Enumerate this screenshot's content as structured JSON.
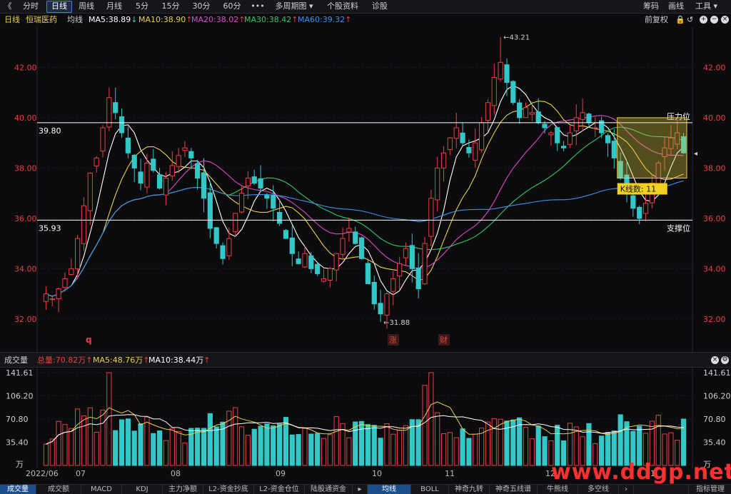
{
  "toolbar": {
    "back": "《",
    "tabs": [
      "分时",
      "日线",
      "周线",
      "月线",
      "5分",
      "15分",
      "30分",
      "60分",
      "•••",
      "多周期图 ▾",
      "个股资料",
      "诊股"
    ],
    "active_tab": "日线",
    "right_items": [
      "筹码",
      "画线",
      "工具 ▾"
    ]
  },
  "info": {
    "period": "日线",
    "stock_name": "恒瑞医药",
    "avg_label": "均线",
    "ma5": "MA5:38.89",
    "ma10": "MA10:38.90",
    "ma20": "MA20:38.02",
    "ma30": "MA30:38.42",
    "ma60": "MA60:39.32",
    "ma5_arrow": "↓",
    "ma10_arrow": "↑",
    "ma20_arrow": "↑",
    "ma30_arrow": "↑",
    "ma60_arrow": "↑",
    "adjust": "前复权"
  },
  "colors": {
    "up": "#e84040",
    "down": "#33c8c8",
    "ma5": "#ffffff",
    "ma10": "#e8d048",
    "ma20": "#e048c8",
    "ma30": "#30c860",
    "ma60": "#3a90e8",
    "axis_text": "#e84040"
  },
  "price_axis": {
    "labels": [
      "42.00",
      "40.00",
      "38.00",
      "36.00",
      "34.00",
      "32.00"
    ]
  },
  "annotations": {
    "high": "43.21",
    "low": "31.88",
    "resistance_value": "39.80",
    "support_value": "35.93",
    "resistance_label": "压力位",
    "support_label": "支撑位",
    "kline_count": "K线数: 11",
    "event_q": "q",
    "event_zhang": "涨",
    "event_cai": "财"
  },
  "volume": {
    "title": "成交量",
    "total": "总量:70.82万",
    "ma5": "MA5:48.76万",
    "ma10": "MA10:38.44万",
    "total_arrow": "↑",
    "ma5_arrow": "↑",
    "ma10_arrow": "↑",
    "axis_labels": [
      "141.61",
      "106.20",
      "70.80",
      "35.40",
      "万"
    ]
  },
  "x_dates": [
    "2022/06",
    "07",
    "08",
    "09",
    "10",
    "11",
    "12",
    "01"
  ],
  "bottom_tabs": [
    "成交量",
    "成交额",
    "MACD",
    "KDJ",
    "主力净额",
    "L2-资金抄底",
    "L2-资金仓位",
    "陆股通资金",
    "▸",
    "均线",
    "BOLL",
    "神奇九转",
    "神奇五线谱",
    "牛熊线",
    "多空线",
    "›",
    "指标管理"
  ],
  "active_bottom_left": "成交量",
  "active_bottom_right": "均线",
  "watermark": "www.ddgp.net",
  "chart_data": {
    "type": "candlestick",
    "title": "恒瑞医药 日线",
    "x": [
      "2022/06",
      "07",
      "08",
      "09",
      "10",
      "11",
      "12",
      "01"
    ],
    "ylim": [
      31.4,
      43.6
    ],
    "key_prices": {
      "high": 43.21,
      "low": 31.88,
      "resistance": 39.8,
      "support": 35.93
    },
    "closes": [
      33.0,
      32.8,
      33.2,
      33.6,
      34.0,
      35.2,
      36.5,
      37.8,
      38.4,
      39.6,
      40.8,
      40.2,
      39.4,
      38.6,
      38.0,
      37.4,
      38.2,
      37.9,
      37.2,
      37.6,
      38.1,
      38.5,
      38.8,
      38.4,
      37.6,
      36.8,
      35.6,
      35.0,
      34.4,
      35.2,
      36.2,
      37.0,
      37.6,
      37.4,
      37.2,
      36.8,
      36.4,
      35.8,
      35.2,
      34.6,
      34.2,
      34.6,
      34.0,
      33.8,
      33.6,
      34.0,
      34.6,
      35.2,
      35.6,
      35.0,
      34.4,
      33.4,
      32.6,
      32.2,
      33.0,
      33.6,
      34.2,
      34.8,
      34.0,
      33.2,
      35.0,
      36.8,
      38.0,
      38.6,
      39.2,
      39.6,
      39.0,
      38.6,
      39.0,
      39.8,
      40.6,
      41.6,
      42.2,
      41.4,
      40.6,
      40.0,
      40.4,
      40.2,
      39.8,
      39.6,
      39.4,
      39.0,
      38.8,
      39.4,
      40.0,
      40.2,
      39.8,
      39.6,
      39.4,
      39.0,
      38.4,
      37.6,
      37.0,
      36.4,
      36.0,
      36.6,
      37.4,
      38.2,
      38.8,
      39.2,
      39.4,
      38.6
    ]
  }
}
